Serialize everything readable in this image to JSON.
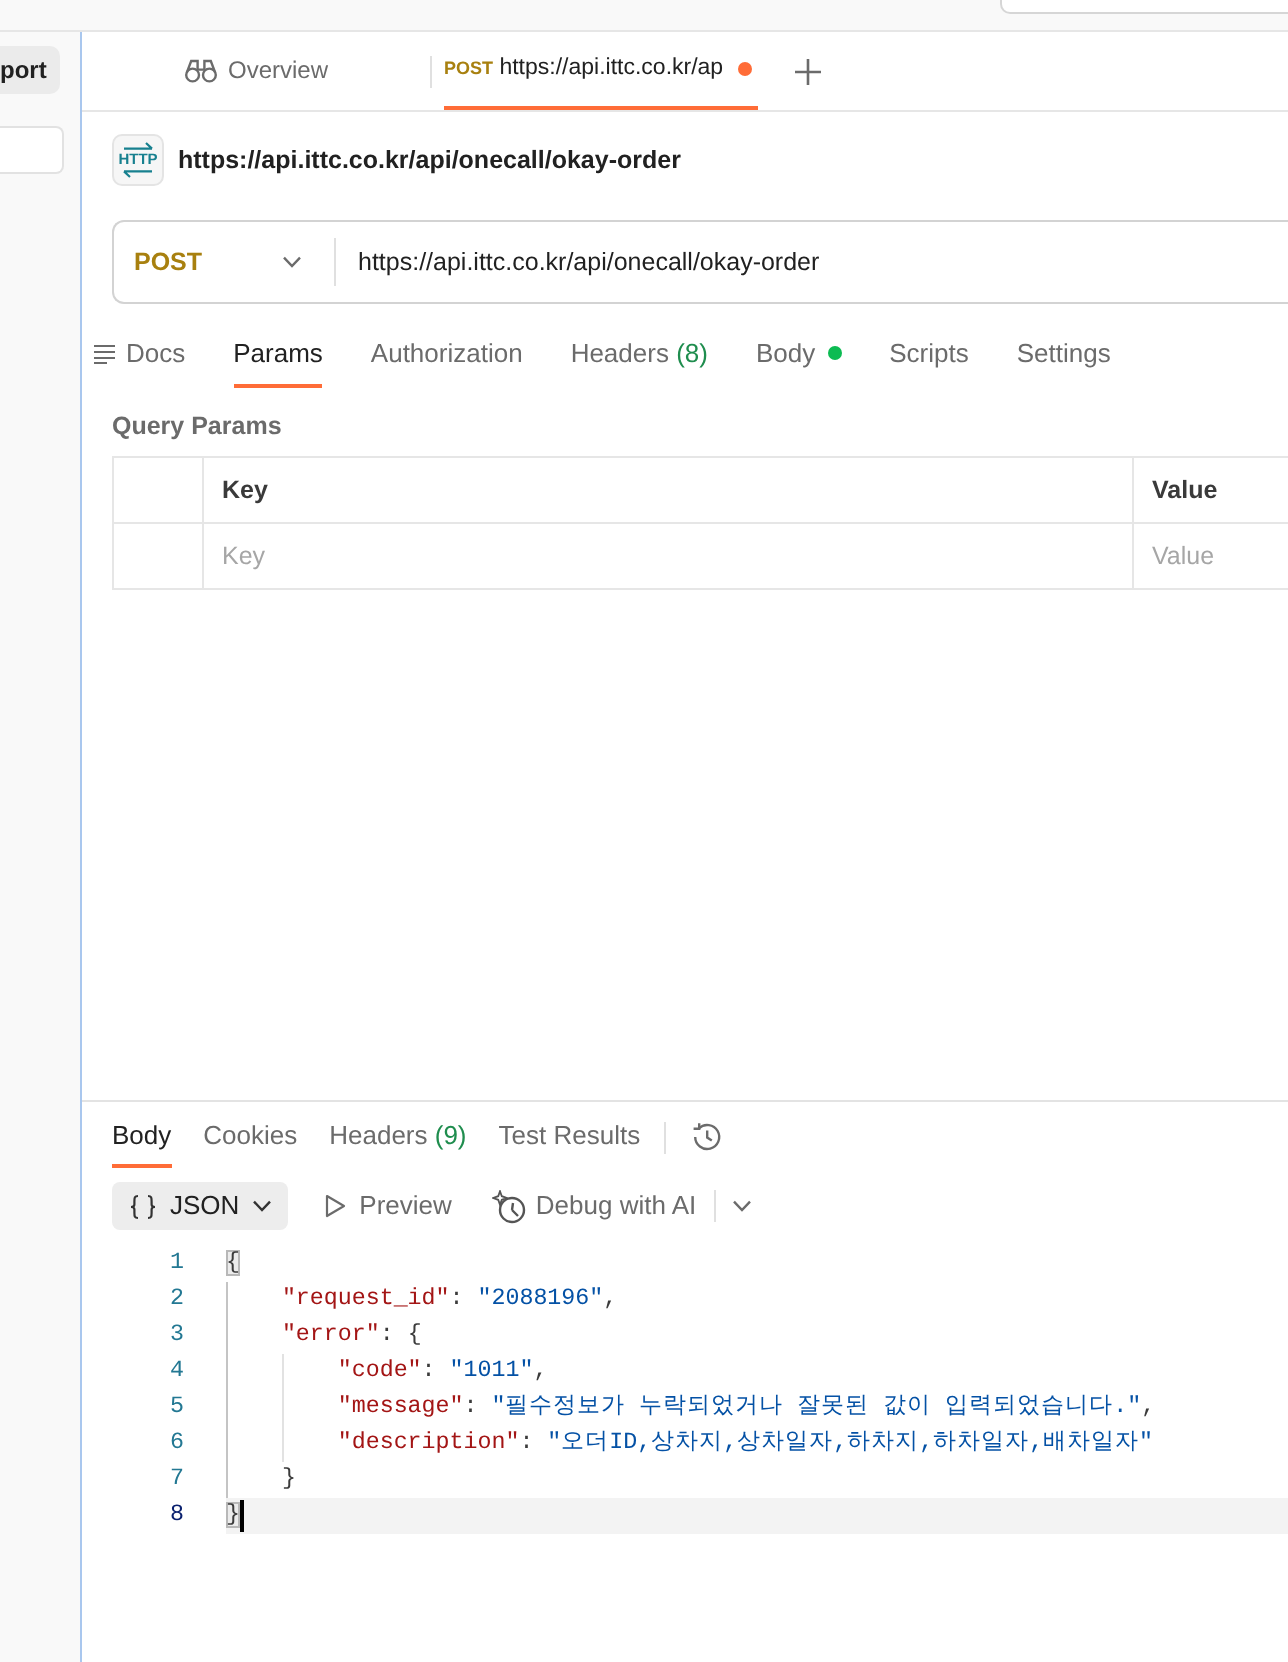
{
  "sidebar": {
    "button": "port"
  },
  "tabs": [
    {
      "kind": "overview",
      "label": "Overview",
      "selected": false,
      "unsaved": false
    },
    {
      "kind": "request",
      "method": "POST",
      "label": "https://api.ittc.co.kr/ap",
      "selected": true,
      "unsaved": true
    }
  ],
  "request": {
    "type_label": "HTTP",
    "title": "https://api.ittc.co.kr/api/onecall/okay-order",
    "method": "POST",
    "url": "https://api.ittc.co.kr/api/onecall/okay-order",
    "tabs": [
      {
        "kind": "docs",
        "label": "Docs",
        "selected": false,
        "has_content": false
      },
      {
        "kind": "plain",
        "label": "Params",
        "selected": true,
        "has_content": false
      },
      {
        "kind": "plain",
        "label": "Authorization",
        "selected": false,
        "has_content": false
      },
      {
        "kind": "plain",
        "label": "Headers",
        "count": "(8)",
        "selected": false,
        "has_content": false
      },
      {
        "kind": "plain",
        "label": "Body",
        "selected": false,
        "has_content": true
      },
      {
        "kind": "plain",
        "label": "Scripts",
        "selected": false,
        "has_content": false
      },
      {
        "kind": "plain",
        "label": "Settings",
        "selected": false,
        "has_content": false
      }
    ]
  },
  "query_params": {
    "title": "Query Params",
    "columns": [
      "Key",
      "Value"
    ],
    "rows": [
      {
        "key": {
          "placeholder": "Key"
        },
        "value": {
          "placeholder": "Value"
        }
      }
    ]
  },
  "response": {
    "tabs": [
      {
        "label": "Body",
        "selected": true
      },
      {
        "label": "Cookies",
        "selected": false
      },
      {
        "label": "Headers",
        "count": "(9)",
        "selected": false
      },
      {
        "label": "Test Results",
        "selected": false
      }
    ],
    "format": "JSON",
    "actions": [
      {
        "kind": "preview",
        "label": "Preview"
      },
      {
        "kind": "debug",
        "label": "Debug with AI"
      }
    ],
    "code": [
      {
        "number": "1",
        "current": false,
        "tokens": [
          {
            "kind": "bracket",
            "text": "{",
            "matched": true
          }
        ],
        "children": [
          {
            "number": "2",
            "current": false,
            "tokens": [
              {
                "kind": "key",
                "text": "\"request_id\""
              },
              {
                "kind": "punct",
                "text": ": "
              },
              {
                "kind": "string",
                "text": "\"2088196\""
              },
              {
                "kind": "punct",
                "text": ","
              }
            ]
          },
          {
            "number": "3",
            "current": false,
            "tokens": [
              {
                "kind": "key",
                "text": "\"error\""
              },
              {
                "kind": "punct",
                "text": ": "
              },
              {
                "kind": "bracket",
                "text": "{",
                "matched": false
              }
            ],
            "children": [
              {
                "number": "4",
                "current": false,
                "tokens": [
                  {
                    "kind": "key",
                    "text": "\"code\""
                  },
                  {
                    "kind": "punct",
                    "text": ": "
                  },
                  {
                    "kind": "string",
                    "text": "\"1011\""
                  },
                  {
                    "kind": "punct",
                    "text": ","
                  }
                ]
              },
              {
                "number": "5",
                "current": false,
                "tokens": [
                  {
                    "kind": "key",
                    "text": "\"message\""
                  },
                  {
                    "kind": "punct",
                    "text": ": "
                  },
                  {
                    "kind": "string",
                    "text": "\"필수정보가 누락되었거나 잘못된 값이 입력되었습니다.\""
                  },
                  {
                    "kind": "punct",
                    "text": ","
                  }
                ]
              },
              {
                "number": "6",
                "current": false,
                "tokens": [
                  {
                    "kind": "key",
                    "text": "\"description\""
                  },
                  {
                    "kind": "punct",
                    "text": ": "
                  },
                  {
                    "kind": "string",
                    "text": "\"오더ID,상차지,상차일자,하차지,하차일자,배차일자\""
                  }
                ]
              }
            ]
          },
          {
            "number": "7",
            "current": false,
            "tokens": [
              {
                "kind": "bracket",
                "text": "}",
                "matched": false
              }
            ]
          }
        ]
      },
      {
        "number": "8",
        "current": true,
        "tokens": [
          {
            "kind": "bracket",
            "text": "}",
            "matched": true
          }
        ]
      }
    ]
  }
}
